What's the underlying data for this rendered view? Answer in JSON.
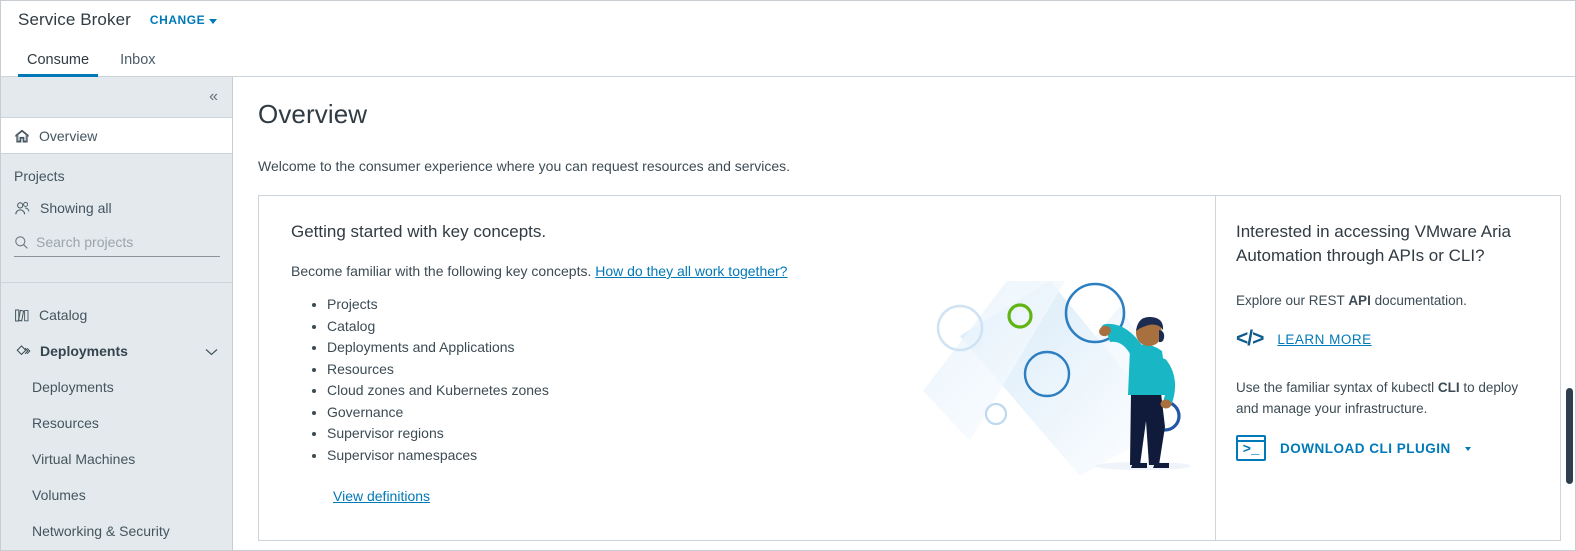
{
  "header": {
    "app_title": "Service Broker",
    "change_label": "CHANGE",
    "change_icon": "chevron-down-icon"
  },
  "tabs": [
    {
      "label": "Consume",
      "active": true
    },
    {
      "label": "Inbox",
      "active": false
    }
  ],
  "sidebar": {
    "collapse_icon": "chevron-double-left-icon",
    "overview": {
      "label": "Overview",
      "icon": "home-icon",
      "selected": true
    },
    "projects_section_label": "Projects",
    "showing_all": {
      "label": "Showing all",
      "icon": "users-icon"
    },
    "search": {
      "placeholder": "Search projects",
      "value": "",
      "icon": "search-icon"
    },
    "catalog": {
      "label": "Catalog",
      "icon": "catalog-books-icon"
    },
    "deployments_group": {
      "label": "Deployments",
      "icon": "deployments-diamond-icon",
      "expand_icon": "chevron-down-icon"
    },
    "sub_items": [
      {
        "label": "Deployments"
      },
      {
        "label": "Resources"
      },
      {
        "label": "Virtual Machines"
      },
      {
        "label": "Volumes"
      },
      {
        "label": "Networking & Security"
      }
    ]
  },
  "main": {
    "page_title": "Overview",
    "welcome": "Welcome to the consumer experience where you can request resources and services.",
    "card": {
      "heading": "Getting started with key concepts.",
      "subtitle_text": "Become familiar with the following key concepts.",
      "subtitle_link": "How do they all work together?",
      "concepts": [
        "Projects",
        "Catalog",
        "Deployments and Applications",
        "Resources",
        "Cloud zones and Kubernetes zones",
        "Governance",
        "Supervisor regions",
        "Supervisor namespaces"
      ],
      "view_definitions": "View definitions",
      "illustration_name": "person-with-bubbles-illustration"
    },
    "right_panel": {
      "heading": "Interested in accessing VMware Aria Automation through APIs or CLI?",
      "api_text_before": "Explore our REST ",
      "api_text_bold": "API",
      "api_text_after": " documentation.",
      "learn_more": "LEARN MORE",
      "learn_more_icon": "code-brackets-icon",
      "cli_text_before": "Use the familiar syntax of kubectl ",
      "cli_text_bold": "CLI",
      "cli_text_after": " to deploy and manage your infrastructure.",
      "download_cli": "DOWNLOAD CLI PLUGIN",
      "download_icon": "terminal-icon",
      "download_caret": "chevron-down-icon"
    }
  },
  "colors": {
    "accent_blue": "#0079b8",
    "sidebar_bg": "#e3e9ed",
    "text_dark": "#313b43",
    "scrollbar_thumb": "#2f3e4d",
    "illustration_cyan": "#19b6c6",
    "illustration_navy": "#101a3a",
    "illustration_green": "#60b515"
  },
  "scrollbar": {
    "name": "vertical-scrollbar"
  }
}
